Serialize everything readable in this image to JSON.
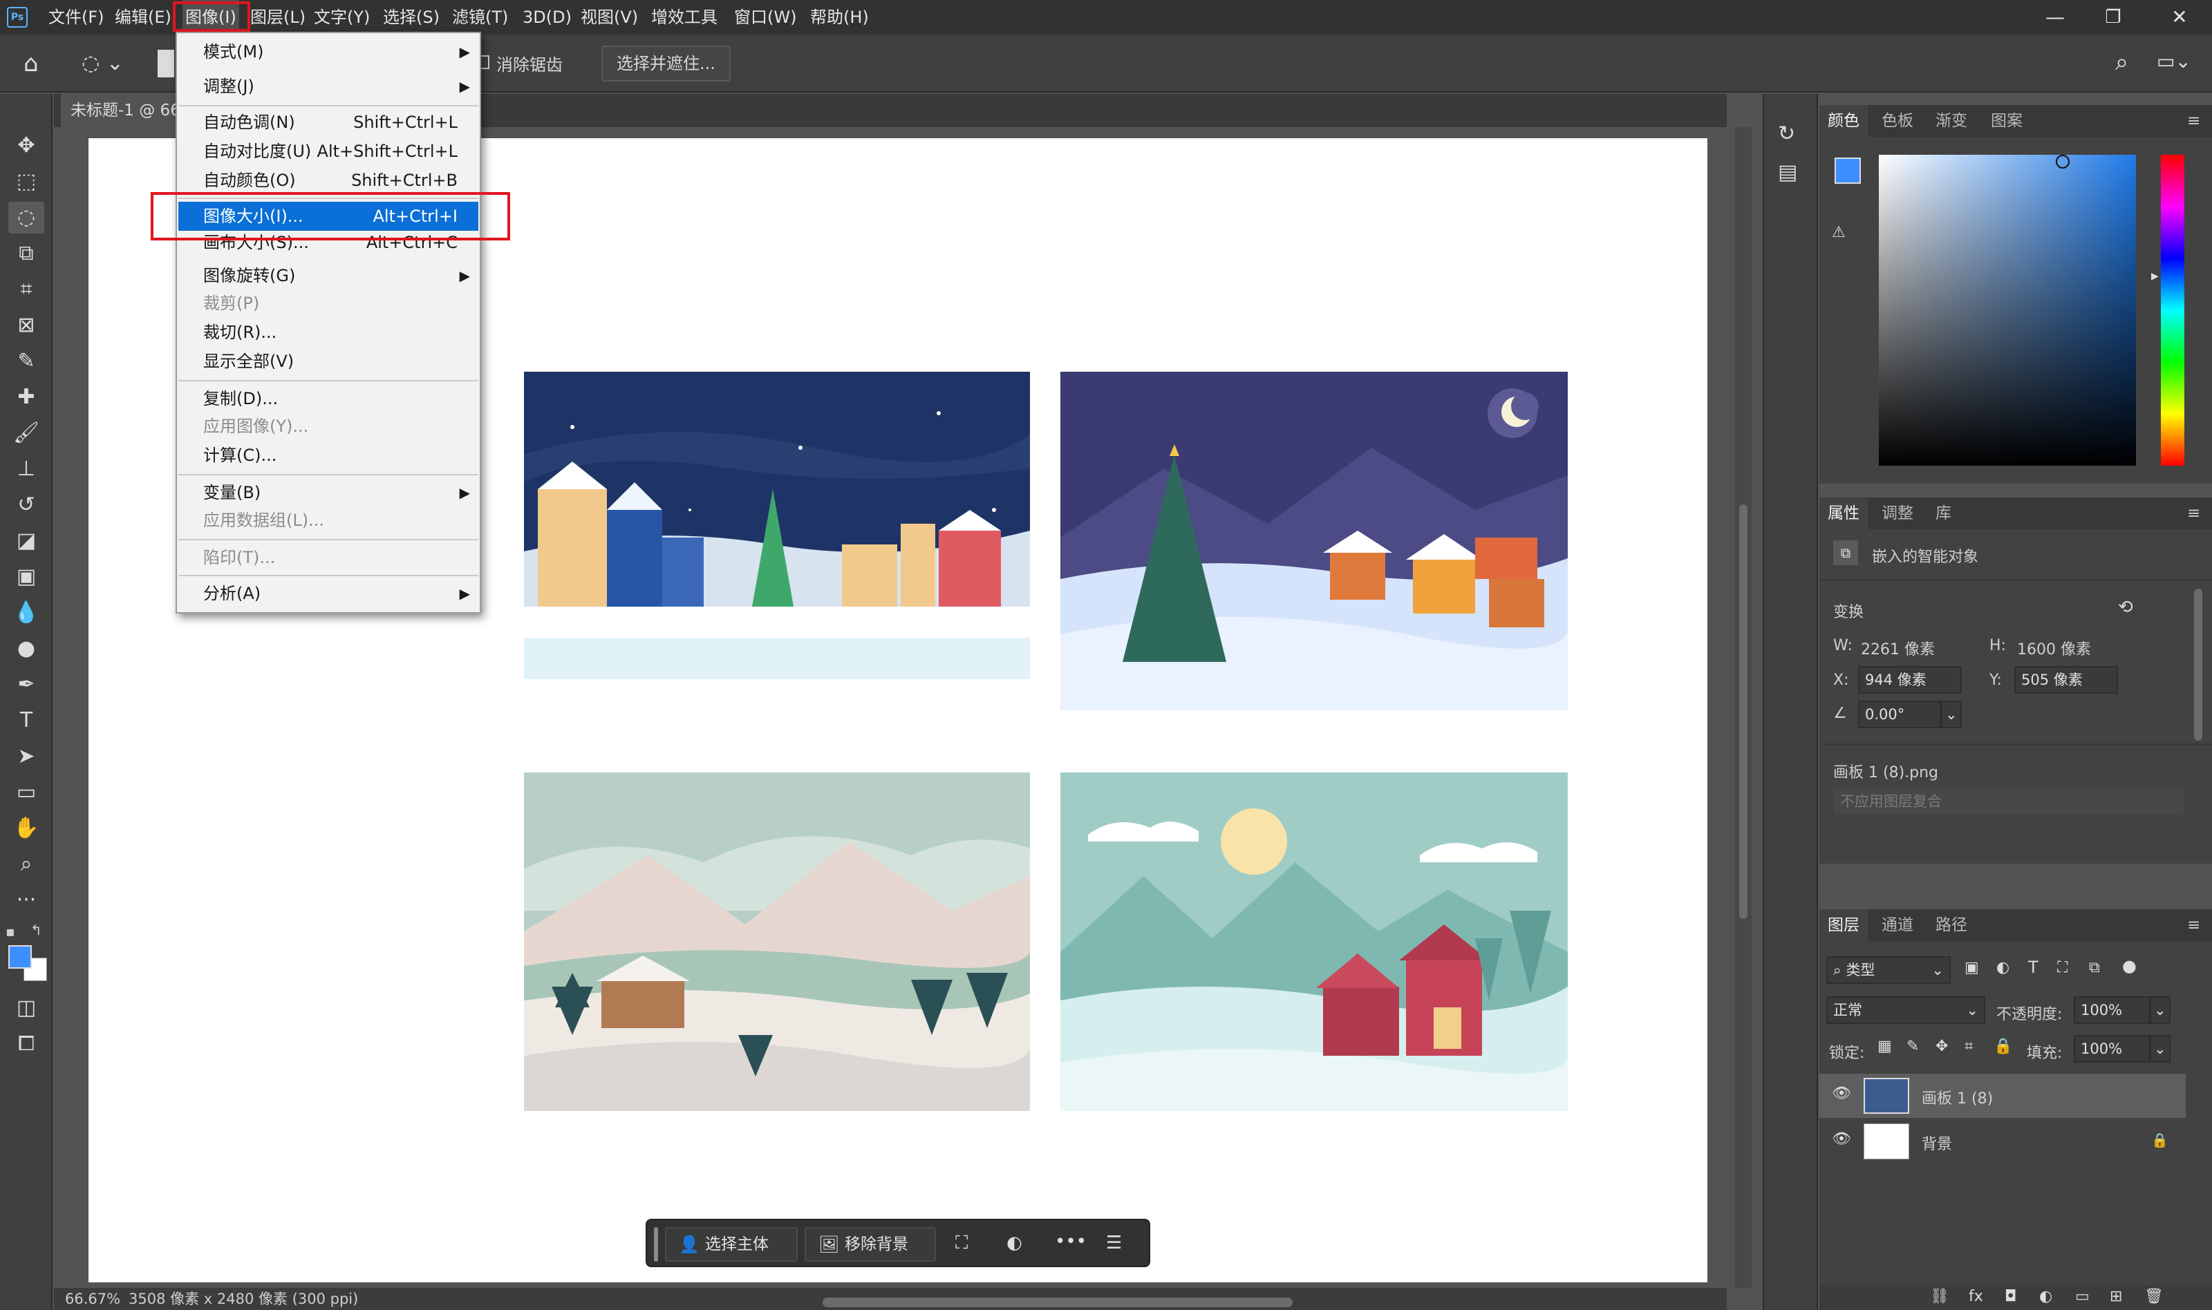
{
  "menubar": {
    "items": [
      "文件(F)",
      "编辑(E)",
      "图像(I)",
      "图层(L)",
      "文字(Y)",
      "选择(S)",
      "滤镜(T)",
      "3D(D)",
      "视图(V)",
      "增效工具",
      "窗口(W)",
      "帮助(H)"
    ],
    "logo": "Ps"
  },
  "options": {
    "antialias": "消除锯齿",
    "select_mask": "选择并遮住..."
  },
  "document": {
    "tab_title": "未标题-1 @ 66",
    "status_zoom": "66.67%",
    "status_size": "3508 像素 x 2480 像素 (300 ppi)"
  },
  "image_menu": {
    "items": [
      {
        "label": "模式(M)",
        "shortcut": "",
        "submenu": true,
        "disabled": false
      },
      {
        "label": "调整(J)",
        "shortcut": "",
        "submenu": true,
        "disabled": false
      },
      {
        "label": "自动色调(N)",
        "shortcut": "Shift+Ctrl+L",
        "submenu": false,
        "disabled": false
      },
      {
        "label": "自动对比度(U)",
        "shortcut": "Alt+Shift+Ctrl+L",
        "submenu": false,
        "disabled": false
      },
      {
        "label": "自动颜色(O)",
        "shortcut": "Shift+Ctrl+B",
        "submenu": false,
        "disabled": false
      },
      {
        "label": "图像大小(I)...",
        "shortcut": "Alt+Ctrl+I",
        "submenu": false,
        "disabled": false
      },
      {
        "label": "画布大小(S)...",
        "shortcut": "Alt+Ctrl+C",
        "submenu": false,
        "disabled": false
      },
      {
        "label": "图像旋转(G)",
        "shortcut": "",
        "submenu": true,
        "disabled": false
      },
      {
        "label": "裁剪(P)",
        "shortcut": "",
        "submenu": false,
        "disabled": true
      },
      {
        "label": "裁切(R)...",
        "shortcut": "",
        "submenu": false,
        "disabled": false
      },
      {
        "label": "显示全部(V)",
        "shortcut": "",
        "submenu": false,
        "disabled": false
      },
      {
        "label": "复制(D)...",
        "shortcut": "",
        "submenu": false,
        "disabled": false
      },
      {
        "label": "应用图像(Y)...",
        "shortcut": "",
        "submenu": false,
        "disabled": true
      },
      {
        "label": "计算(C)...",
        "shortcut": "",
        "submenu": false,
        "disabled": false
      },
      {
        "label": "变量(B)",
        "shortcut": "",
        "submenu": true,
        "disabled": false
      },
      {
        "label": "应用数据组(L)...",
        "shortcut": "",
        "submenu": false,
        "disabled": true
      },
      {
        "label": "陷印(T)...",
        "shortcut": "",
        "submenu": false,
        "disabled": true
      },
      {
        "label": "分析(A)",
        "shortcut": "",
        "submenu": true,
        "disabled": false
      }
    ]
  },
  "color_panel": {
    "tabs": [
      "颜色",
      "色板",
      "渐变",
      "图案"
    ],
    "foreground": "#3d8fff"
  },
  "properties_panel": {
    "tabs": [
      "属性",
      "调整",
      "库"
    ],
    "object_type": "嵌入的智能对象",
    "transform_label": "变换",
    "w_label": "W:",
    "w_value": "2261 像素",
    "h_label": "H:",
    "h_value": "1600 像素",
    "x_label": "X:",
    "x_value": "944 像素",
    "y_label": "Y:",
    "y_value": "505 像素",
    "angle_value": "0.00°",
    "filename": "画板 1 (8).png",
    "layer_comp": "不应用图层复合"
  },
  "layers_panel": {
    "tabs": [
      "图层",
      "通道",
      "路径"
    ],
    "filter_kind": "类型",
    "blend_mode": "正常",
    "opacity_label": "不透明度:",
    "opacity_value": "100%",
    "lock_label": "锁定:",
    "fill_label": "填充:",
    "fill_value": "100%",
    "layers": [
      {
        "name": "画板 1 (8)"
      },
      {
        "name": "背景"
      }
    ]
  },
  "context_bar": {
    "select_subject": "选择主体",
    "remove_bg": "移除背景"
  }
}
